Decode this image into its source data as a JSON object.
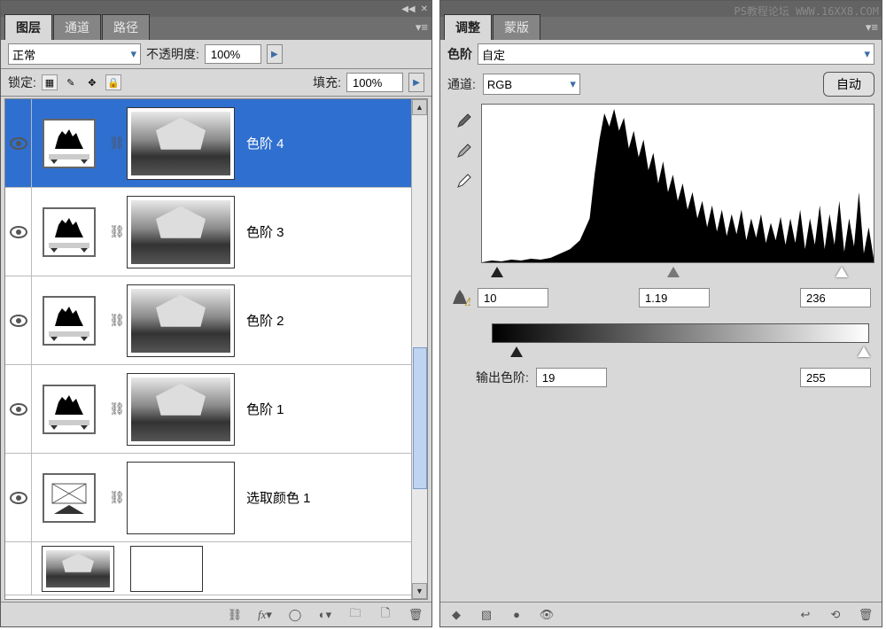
{
  "watermark": "PS教程论坛 WWW.16XX8.COM",
  "layers_panel": {
    "tabs": [
      "图层",
      "通道",
      "路径"
    ],
    "active_tab": 0,
    "blend_mode": "正常",
    "opacity_label": "不透明度:",
    "opacity_value": "100%",
    "lock_label": "锁定:",
    "fill_label": "填充:",
    "fill_value": "100%",
    "layers": [
      {
        "name": "色阶 4",
        "type": "levels",
        "selected": true,
        "visible": true
      },
      {
        "name": "色阶 3",
        "type": "levels",
        "selected": false,
        "visible": true
      },
      {
        "name": "色阶 2",
        "type": "levels",
        "selected": false,
        "visible": true
      },
      {
        "name": "色阶 1",
        "type": "levels",
        "selected": false,
        "visible": true
      },
      {
        "name": "选取颜色 1",
        "type": "selective-color",
        "selected": false,
        "visible": true
      }
    ]
  },
  "adjust_panel": {
    "tabs": [
      "调整",
      "蒙版"
    ],
    "active_tab": 0,
    "adj_type_label": "色阶",
    "preset": "自定",
    "channel_label": "通道:",
    "channel_value": "RGB",
    "auto_label": "自动",
    "input_black": "10",
    "input_mid": "1.19",
    "input_white": "236",
    "output_label": "输出色阶:",
    "output_black": "19",
    "output_white": "255"
  }
}
